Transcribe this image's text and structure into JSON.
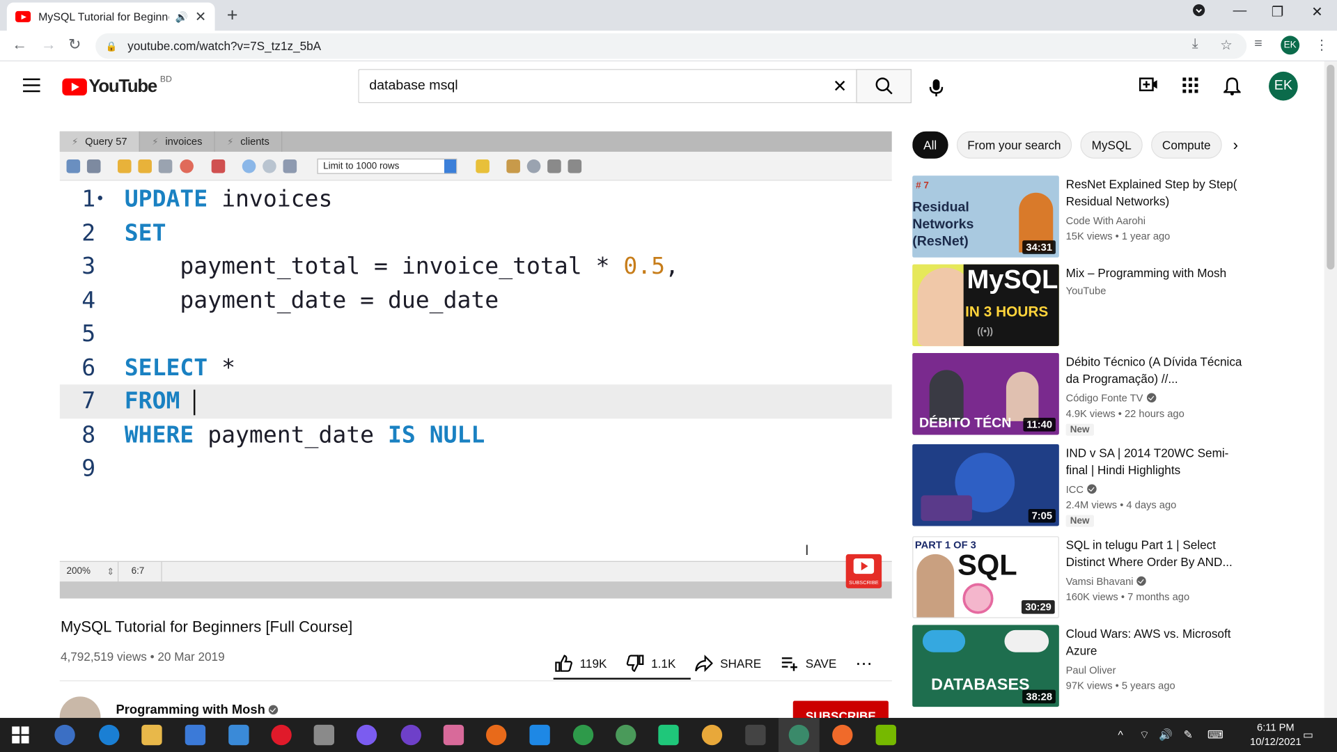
{
  "browser": {
    "tab_title": "MySQL Tutorial for Beginners [Full Course] - YouTube",
    "url": "youtube.com/watch?v=7S_tz1z_5bA",
    "profile_initials": "EK"
  },
  "masthead": {
    "logo_text": "YouTube",
    "country_code": "BD",
    "search_value": "database msql",
    "avatar_initials": "EK"
  },
  "workbench": {
    "tabs": [
      "Query 57",
      "invoices",
      "clients"
    ],
    "limit_select": "Limit to 1000 rows",
    "zoom": "200%",
    "cursor_pos": "6:7",
    "line_numbers": [
      "1",
      "2",
      "3",
      "4",
      "5",
      "6",
      "7",
      "8",
      "9"
    ],
    "line1_marker": "•",
    "code": {
      "l1_kw": "UPDATE",
      "l1_rest": " invoices",
      "l2_kw": "SET",
      "l3_a": "    payment_total = invoice_total * ",
      "l3_num": "0.5",
      "l3_b": ",",
      "l4": "    payment_date = due_date",
      "l6_kw": "SELECT",
      "l6_rest": " *",
      "l7_kw": "FROM",
      "l7_rest": " ",
      "l8_kw1": "WHERE",
      "l8_mid": " payment_date ",
      "l8_kw2": "IS NULL"
    },
    "subscribe_watermark": "SUBSCRIBE"
  },
  "video": {
    "title": "MySQL Tutorial for Beginners [Full Course]",
    "views_date": "4,792,519 views • 20 Mar 2019",
    "likes": "119K",
    "dislikes": "1.1K",
    "share_label": "SHARE",
    "save_label": "SAVE",
    "channel": "Programming with Mosh",
    "subscribe_label": "SUBSCRIBE"
  },
  "chips": [
    "All",
    "From your search",
    "MySQL",
    "Compute"
  ],
  "recommendations": [
    {
      "title": "ResNet Explained Step by Step( Residual Networks)",
      "channel": "Code With Aarohi",
      "meta": "15K views • 1 year ago",
      "duration": "34:31",
      "thumb_text": "Residual Networks (ResNet)",
      "thumb_tag": "# 7",
      "verified": false,
      "new": false,
      "color": "#a9c9e0"
    },
    {
      "title": "Mix – Programming with Mosh",
      "channel": "YouTube",
      "meta": "",
      "duration": "",
      "thumb_text": "MySQL",
      "thumb_text2": "IN 3 HOURS",
      "verified": false,
      "new": false,
      "color": "#e6e85a"
    },
    {
      "title": "Débito Técnico (A Dívida Técnica da Programação) //...",
      "channel": "Código Fonte TV",
      "meta": "4.9K views • 22 hours ago",
      "duration": "11:40",
      "thumb_text": "DÉBITO TÉCN",
      "verified": true,
      "new": true,
      "color": "#7a2a8e"
    },
    {
      "title": "IND v SA | 2014 T20WC Semi-final | Hindi Highlights",
      "channel": "ICC",
      "meta": "2.4M views • 4 days ago",
      "duration": "7:05",
      "verified": true,
      "new": true,
      "color": "#1f3e86"
    },
    {
      "title": "SQL in telugu Part 1 | Select Distinct Where Order By AND...",
      "channel": "Vamsi Bhavani",
      "meta": "160K views • 7 months ago",
      "duration": "30:29",
      "thumb_text": "PART 1 OF 3",
      "thumb_text2": "SQL",
      "verified": true,
      "new": false,
      "color": "#ffffff"
    },
    {
      "title": "Cloud Wars: AWS vs. Microsoft Azure",
      "channel": "Paul Oliver",
      "meta": "97K views • 5 years ago",
      "duration": "38:28",
      "thumb_text": "DATABASES",
      "verified": false,
      "new": false,
      "color": "#1e6e4e"
    }
  ],
  "new_label": "New",
  "taskbar": {
    "time": "6:11 PM",
    "date": "10/12/2021"
  }
}
